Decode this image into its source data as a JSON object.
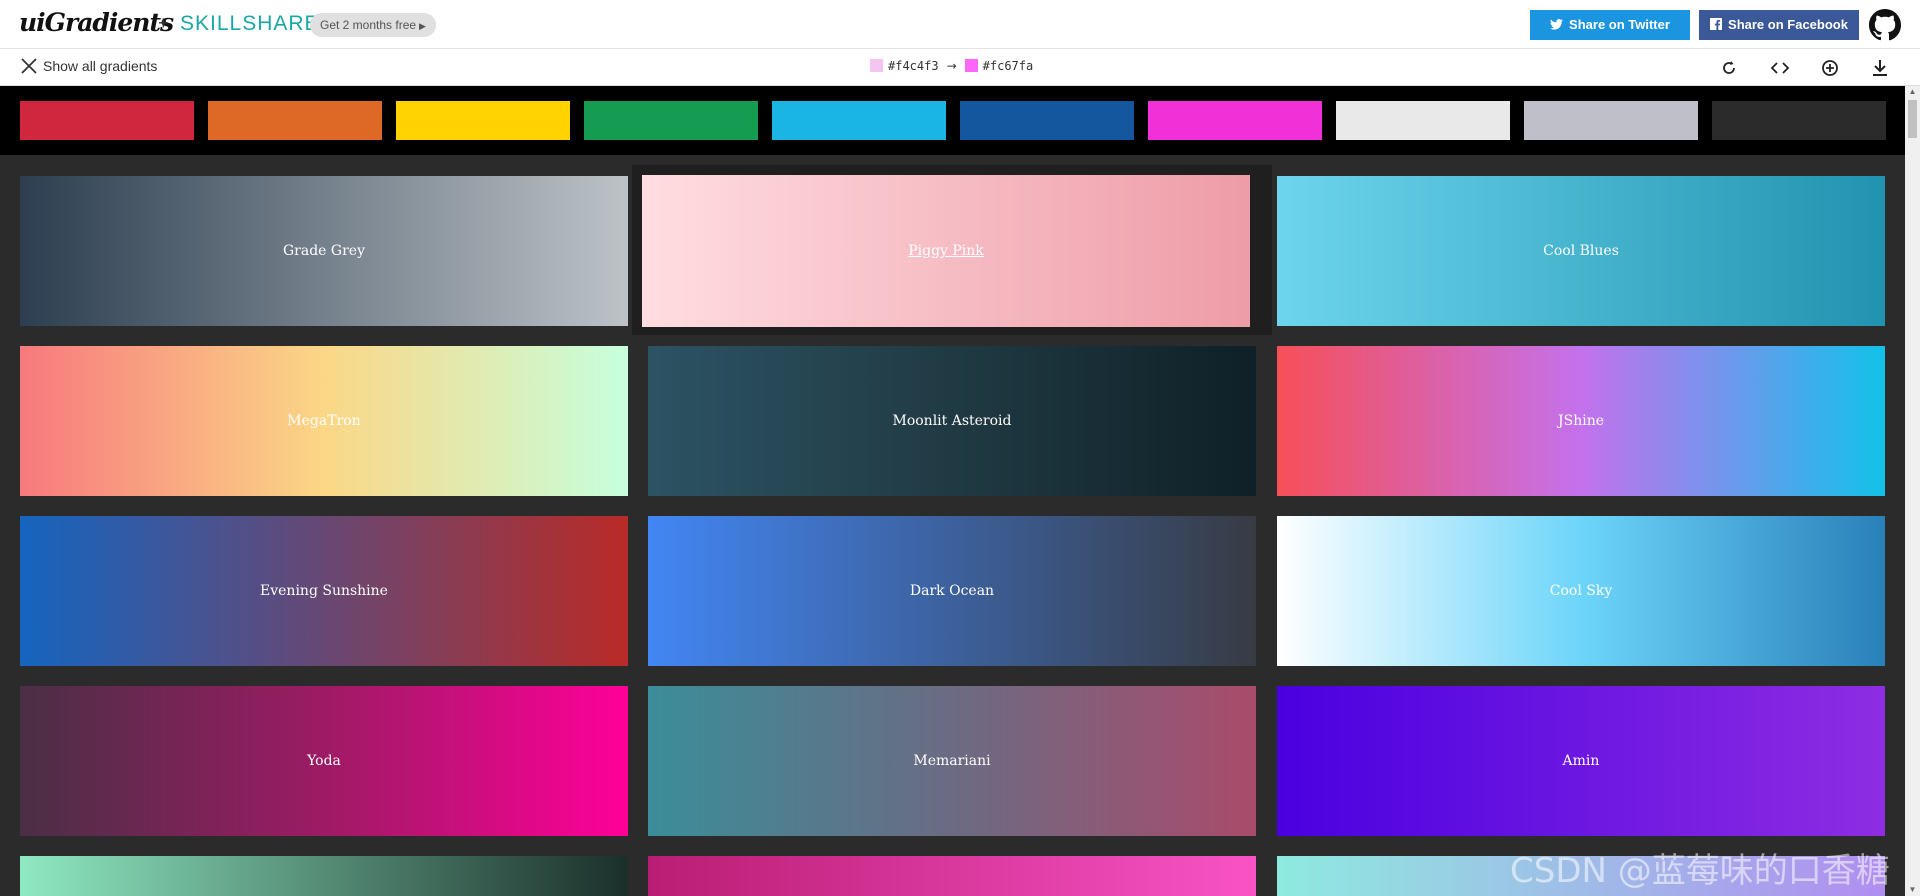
{
  "header": {
    "logo": "uiGradients",
    "plus": "+",
    "partner": "SKILLSHARE",
    "promo": "Get 2 months free",
    "share_twitter": "Share on Twitter",
    "share_facebook": "Share on Facebook"
  },
  "toolbar": {
    "show_all": "Show all gradients",
    "color_from": "#f4c4f3",
    "color_to": "#fc67fa",
    "arrow": "→"
  },
  "filters": [
    {
      "color": "#d0273f"
    },
    {
      "color": "#de6826"
    },
    {
      "color": "#ffd200"
    },
    {
      "color": "#169b52"
    },
    {
      "color": "#1bb5e3"
    },
    {
      "color": "#15579f"
    },
    {
      "color": "#f130d8"
    },
    {
      "color": "#e9e9e9"
    },
    {
      "color": "#bebfc8"
    },
    {
      "color": "#2b2b2b"
    }
  ],
  "gradients": [
    {
      "name": "Grade Grey",
      "from": "#2c3e50",
      "to": "#bdc3c7"
    },
    {
      "name": "Piggy Pink",
      "from": "#ffdde1",
      "to": "#ee9ca7",
      "active": true
    },
    {
      "name": "Cool Blues",
      "from": "#6dd5ed",
      "to": "#2193b0"
    },
    {
      "name": "MegaTron",
      "from": "#f7797d",
      "via": "#fbd786",
      "to": "#c6ffdd"
    },
    {
      "name": "Moonlit Asteroid",
      "from": "#2c5364",
      "via": "#203a43",
      "to": "#0f2027"
    },
    {
      "name": "JShine",
      "from": "#f64f59",
      "via": "#c471ed",
      "to": "#12c2e9"
    },
    {
      "name": "Evening Sunshine",
      "from": "#1565c0",
      "to": "#b92b27"
    },
    {
      "name": "Dark Ocean",
      "from": "#4286f4",
      "to": "#373b44"
    },
    {
      "name": "Cool Sky",
      "from": "#ffffff",
      "via": "#6dd5fa",
      "to": "#2980b9"
    },
    {
      "name": "Yoda",
      "from": "#4a2f45",
      "via": "#9d1b64",
      "to": "#ff0099"
    },
    {
      "name": "Memariani",
      "from": "#3b8d99",
      "via": "#6b6b83",
      "to": "#aa4b6b"
    },
    {
      "name": "Amin",
      "from": "#4a00e0",
      "to": "#8e2de2"
    },
    {
      "name": "",
      "from": "#8fe9c2",
      "to": "#1b2f2a"
    },
    {
      "name": "",
      "from": "#b91d73",
      "to": "#f953c6"
    },
    {
      "name": "",
      "from": "#8eeadf",
      "to": "#b08ef0"
    }
  ],
  "watermark": "CSDN @蓝莓味的口香糖"
}
